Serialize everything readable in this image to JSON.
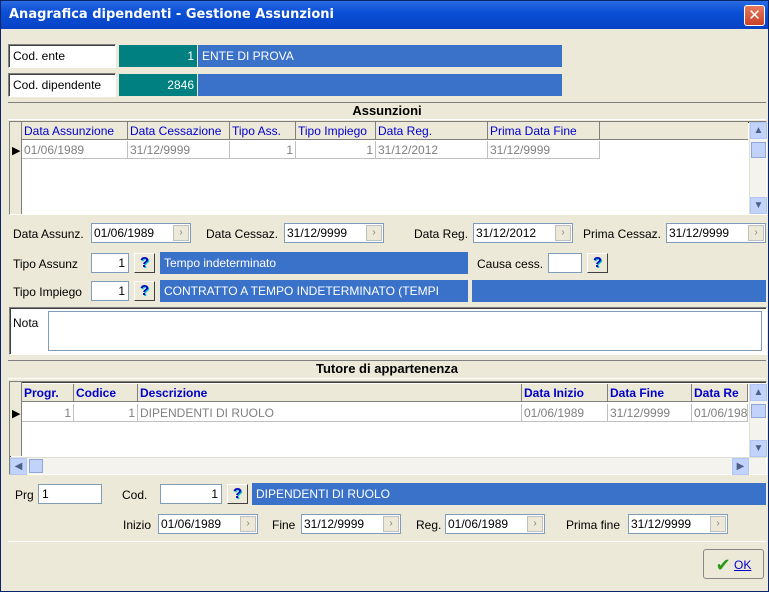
{
  "window": {
    "title": "Anagrafica dipendenti - Gestione Assunzioni",
    "close_glyph": "✕"
  },
  "header": {
    "cod_ente_label": "Cod. ente",
    "cod_ente_value": "1",
    "ente_name": "ENTE DI PROVA",
    "cod_dipendente_label": "Cod. dipendente",
    "cod_dipendente_value": "2846",
    "dipendente_name": ""
  },
  "assunzioni": {
    "section_title": "Assunzioni",
    "columns": [
      "Data Assunzione",
      "Data Cessazione",
      "Tipo Ass.",
      "Tipo Impiego",
      "Data Reg.",
      "Prima Data Fine"
    ],
    "rows": [
      [
        "01/06/1989",
        "31/12/9999",
        "1",
        "1",
        "31/12/2012",
        "31/12/9999"
      ]
    ]
  },
  "detail": {
    "data_assunz_label": "Data Assunz.",
    "data_assunz_value": "01/06/1989",
    "data_cessaz_label": "Data Cessaz.",
    "data_cessaz_value": "31/12/9999",
    "data_reg_label": "Data Reg.",
    "data_reg_value": "31/12/2012",
    "prima_cessaz_label": "Prima Cessaz.",
    "prima_cessaz_value": "31/12/9999",
    "tipo_assunz_label": "Tipo Assunz",
    "tipo_assunz_code": "1",
    "tipo_assunz_desc": "Tempo indeterminato",
    "causa_cess_label": "Causa cess.",
    "causa_cess_value": "",
    "tipo_impiego_label": "Tipo Impiego",
    "tipo_impiego_code": "1",
    "tipo_impiego_desc": "CONTRATTO A TEMPO INDETERMINATO (TEMPI",
    "nota_label": "Nota",
    "nota_value": "",
    "lookup_glyph": "?",
    "date_button_glyph": "›"
  },
  "tutore": {
    "section_title": "Tutore di appartenenza",
    "columns": [
      "Progr.",
      "Codice",
      "Descrizione",
      "Data Inizio",
      "Data Fine",
      "Data Re"
    ],
    "rows": [
      [
        "1",
        "1",
        "DIPENDENTI DI RUOLO",
        "01/06/1989",
        "31/12/9999",
        "01/06/198"
      ]
    ]
  },
  "tutore_detail": {
    "prg_label": "Prg",
    "prg_value": "1",
    "cod_label": "Cod.",
    "cod_value": "1",
    "cod_desc": "DIPENDENTI DI RUOLO",
    "inizio_label": "Inizio",
    "inizio_value": "01/06/1989",
    "fine_label": "Fine",
    "fine_value": "31/12/9999",
    "reg_label": "Reg.",
    "reg_value": "01/06/1989",
    "prima_fine_label": "Prima fine",
    "prima_fine_value": "31/12/9999"
  },
  "footer": {
    "ok_label": "OK",
    "ok_icon": "✔"
  },
  "colors": {
    "titlebar": "#0a4fd6",
    "accent_blue": "#3a72c9",
    "teal": "#008080",
    "dialog_bg": "#ece9d8"
  }
}
